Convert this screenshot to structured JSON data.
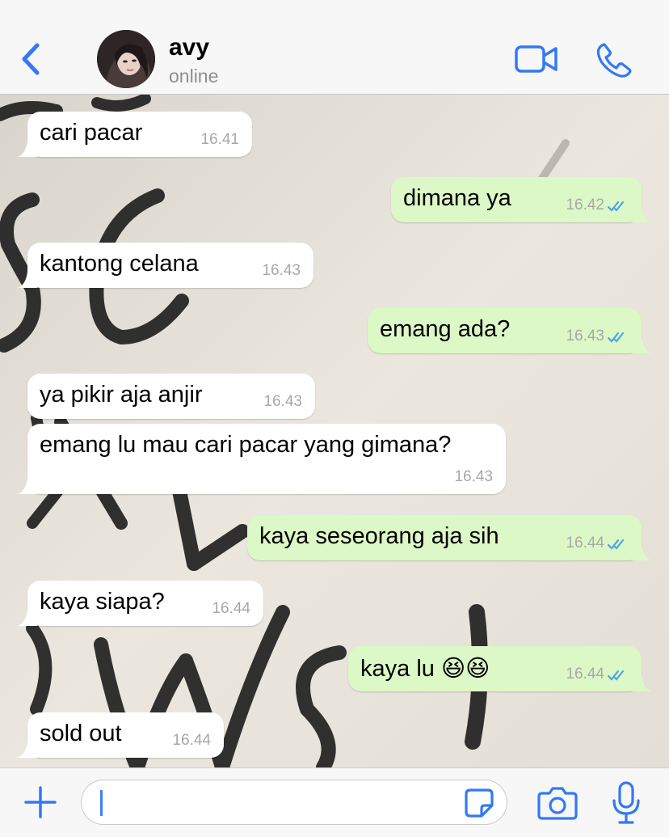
{
  "header": {
    "contact_name": "avy",
    "status": "online",
    "accent_color": "#3478f6"
  },
  "icons": {
    "back": "chevron-left",
    "video": "video-camera",
    "call": "phone",
    "attach": "plus",
    "sticker": "sticker",
    "camera": "camera",
    "mic": "microphone"
  },
  "messages": [
    {
      "direction": "in",
      "text": "cari pacar",
      "time": "16.41"
    },
    {
      "direction": "out",
      "text": "dimana ya",
      "time": "16.42",
      "read": true
    },
    {
      "direction": "in",
      "text": "kantong celana",
      "time": "16.43"
    },
    {
      "direction": "out",
      "text": "emang ada?",
      "time": "16.43",
      "read": true
    },
    {
      "direction": "in",
      "text": "ya pikir aja anjir",
      "time": "16.43"
    },
    {
      "direction": "in",
      "text": "emang lu mau cari pacar yang gimana?",
      "time": "16.43"
    },
    {
      "direction": "out",
      "text": "kaya seseorang aja sih",
      "time": "16.44",
      "read": true
    },
    {
      "direction": "in",
      "text": "kaya siapa?",
      "time": "16.44"
    },
    {
      "direction": "out",
      "text": "kaya lu 😆😆",
      "time": "16.44",
      "read": true
    },
    {
      "direction": "in",
      "text": "sold out",
      "time": "16.44"
    }
  ],
  "input": {
    "value": "",
    "placeholder": ""
  },
  "colors": {
    "incoming_bubble": "#ffffff",
    "outgoing_bubble": "#dcf8c6",
    "read_ticks": "#4fa3e0"
  }
}
